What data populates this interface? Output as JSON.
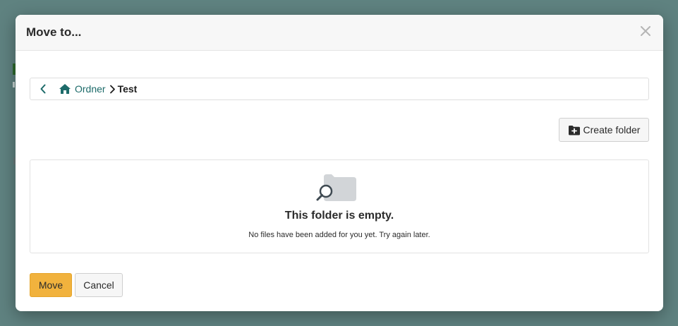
{
  "dialog": {
    "title": "Move to...",
    "close_icon": "close-icon"
  },
  "breadcrumb": {
    "back_icon": "chevron-left-icon",
    "home_icon": "home-icon",
    "home_label": "Ordner",
    "separator_icon": "chevron-right-icon",
    "current": "Test"
  },
  "toolbar": {
    "create_folder_label": "Create folder",
    "create_folder_icon": "folder-plus-icon"
  },
  "empty_state": {
    "icon": "folder-search-icon",
    "title": "This folder is empty.",
    "message": "No files have been added for you yet. Try again later."
  },
  "footer": {
    "move_label": "Move",
    "cancel_label": "Cancel"
  },
  "colors": {
    "accent": "#f1b23d",
    "link": "#1d6b6a",
    "backdrop": "#5f8280"
  }
}
